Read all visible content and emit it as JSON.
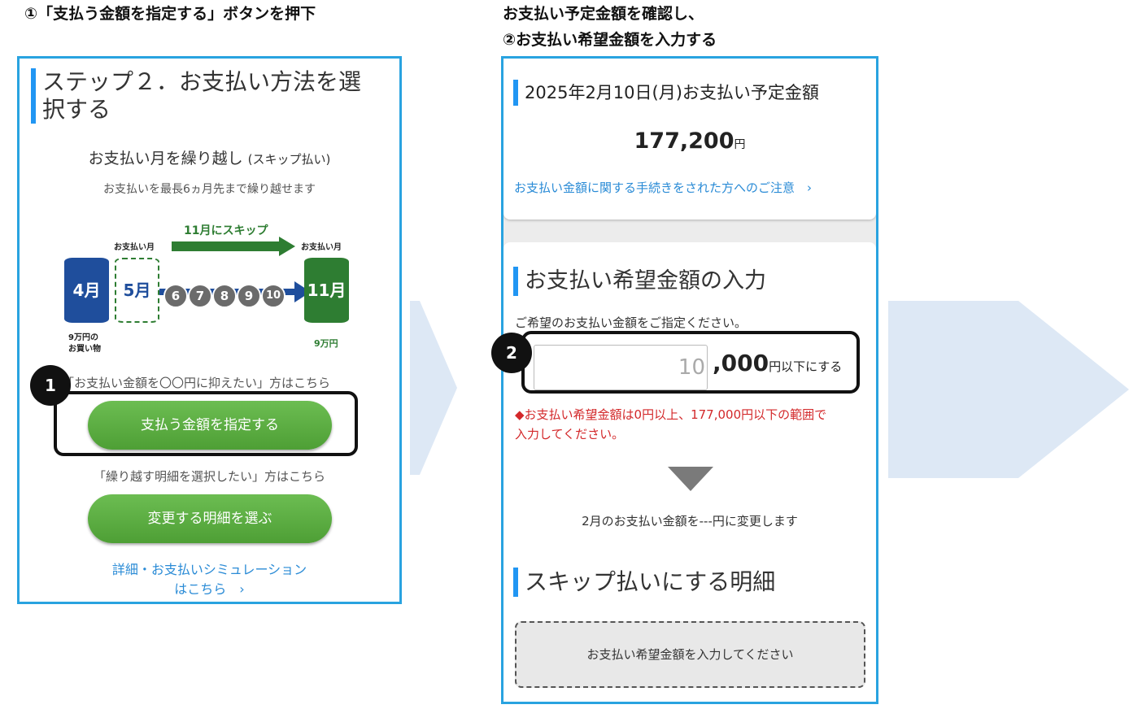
{
  "captions": {
    "left": "①「支払う金額を指定する」ボタンを押下",
    "right_line1": "お支払い予定金額を確認し、",
    "right_line2": "②お支払い希望金額を入力する"
  },
  "left_panel": {
    "step_title_line1": "ステップ２．お支払い方法を選",
    "step_title_line2": "択する",
    "skip_heading": "お支払い月を繰り越し",
    "skip_heading_sub": "(スキップ払い)",
    "skip_desc": "お支払いを最長6ヵ月先まで繰り越せます",
    "graphic": {
      "arrow_label": "11月にスキップ",
      "pay_month_left": "お支払い月",
      "pay_month_right": "お支払い月",
      "month_4": "4月",
      "month_5": "5月",
      "months_mid": [
        "6",
        "7",
        "8",
        "9",
        "10"
      ],
      "month_11": "11月",
      "note_left_line1": "9万円の",
      "note_left_line2": "お買い物",
      "note_right": "9万円"
    },
    "limit_prompt": "「お支払い金額を〇〇円に抑えたい」方はこちら",
    "specify_button": "支払う金額を指定する",
    "select_prompt": "「繰り越す明細を選択したい」方はこちら",
    "select_button": "変更する明細を選ぶ",
    "detail_link_line1": "詳細・お支払いシミュレーション",
    "detail_link_line2": "はこちら　›"
  },
  "right_panel": {
    "scheduled_title": "2025年2月10日(月)お支払い予定金額",
    "scheduled_amount": "177,200",
    "yen": "円",
    "notice_link": "お支払い金額に関する手続きをされた方へのご注意　›",
    "input_heading": "お支払い希望金額の入力",
    "input_instruction": "ご希望のお支払い金額をご指定ください。",
    "input_value": "10",
    "input_suffix_amount": ",000",
    "input_suffix_unit": "円以下にする",
    "error_text_line1": "◆お支払い希望金額は0円以上、177,000円以下の範囲で",
    "error_text_line2": "入力してください。",
    "change_text": "2月のお支払い金額を---円に変更します",
    "skip_detail_heading": "スキップ払いにする明細",
    "placeholder_text": "お支払い希望金額を入力してください"
  },
  "badges": {
    "one": "1",
    "two": "2"
  },
  "colors": {
    "frame_border": "#29a3e0",
    "heading_bar": "#2196f3",
    "button_green": "#5aad40",
    "month_blue": "#1f4e9c",
    "month_green": "#2e7d32",
    "error_red": "#d3282a",
    "arrow_bg": "#dde8f5"
  }
}
